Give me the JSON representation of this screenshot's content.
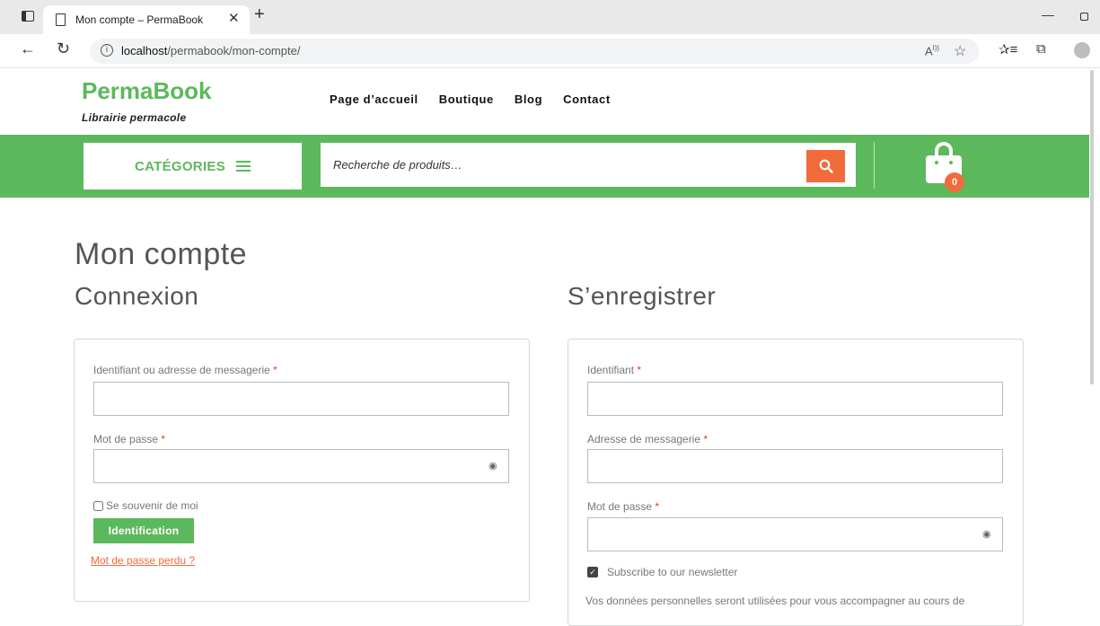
{
  "browser": {
    "tab_title": "Mon compte – PermaBook",
    "url_host": "localhost",
    "url_path": "/permabook/mon-compte/",
    "icons": [
      "sidebar-toggle-icon",
      "page-icon",
      "close-icon",
      "plus-icon",
      "back-arrow-icon",
      "reload-icon",
      "info-icon",
      "read-aloud-icon",
      "add-favorite-icon",
      "favorites-icon",
      "collections-icon",
      "profile-icon",
      "minimize-icon",
      "restore-icon"
    ]
  },
  "site": {
    "brand": "PermaBook",
    "tagline": "Librairie permacole",
    "brand_color": "#5cb85c",
    "accent_color": "#f26b3a",
    "nav": [
      "Page d’accueil",
      "Boutique",
      "Blog",
      "Contact"
    ]
  },
  "bar": {
    "categories_label": "CATÉGORIES",
    "search_placeholder": "Recherche de produits…",
    "cart_count": "0",
    "icons": [
      "menu-icon",
      "search-icon",
      "shopping-bag-icon"
    ]
  },
  "page": {
    "title": "Mon compte"
  },
  "login": {
    "heading": "Connexion",
    "username_label": "Identifiant ou adresse de messagerie",
    "password_label": "Mot de passe",
    "required_mark": "*",
    "remember_label": "Se souvenir de moi",
    "submit_label": "Identification",
    "lost_password": "Mot de passe perdu ?"
  },
  "register": {
    "heading": "S’enregistrer",
    "username_label": "Identifiant",
    "email_label": "Adresse de messagerie",
    "password_label": "Mot de passe",
    "newsletter_label": "Subscribe to our newsletter",
    "newsletter_checked": true,
    "privacy_text": "Vos données personnelles seront utilisées pour vous accompagner au cours de"
  }
}
